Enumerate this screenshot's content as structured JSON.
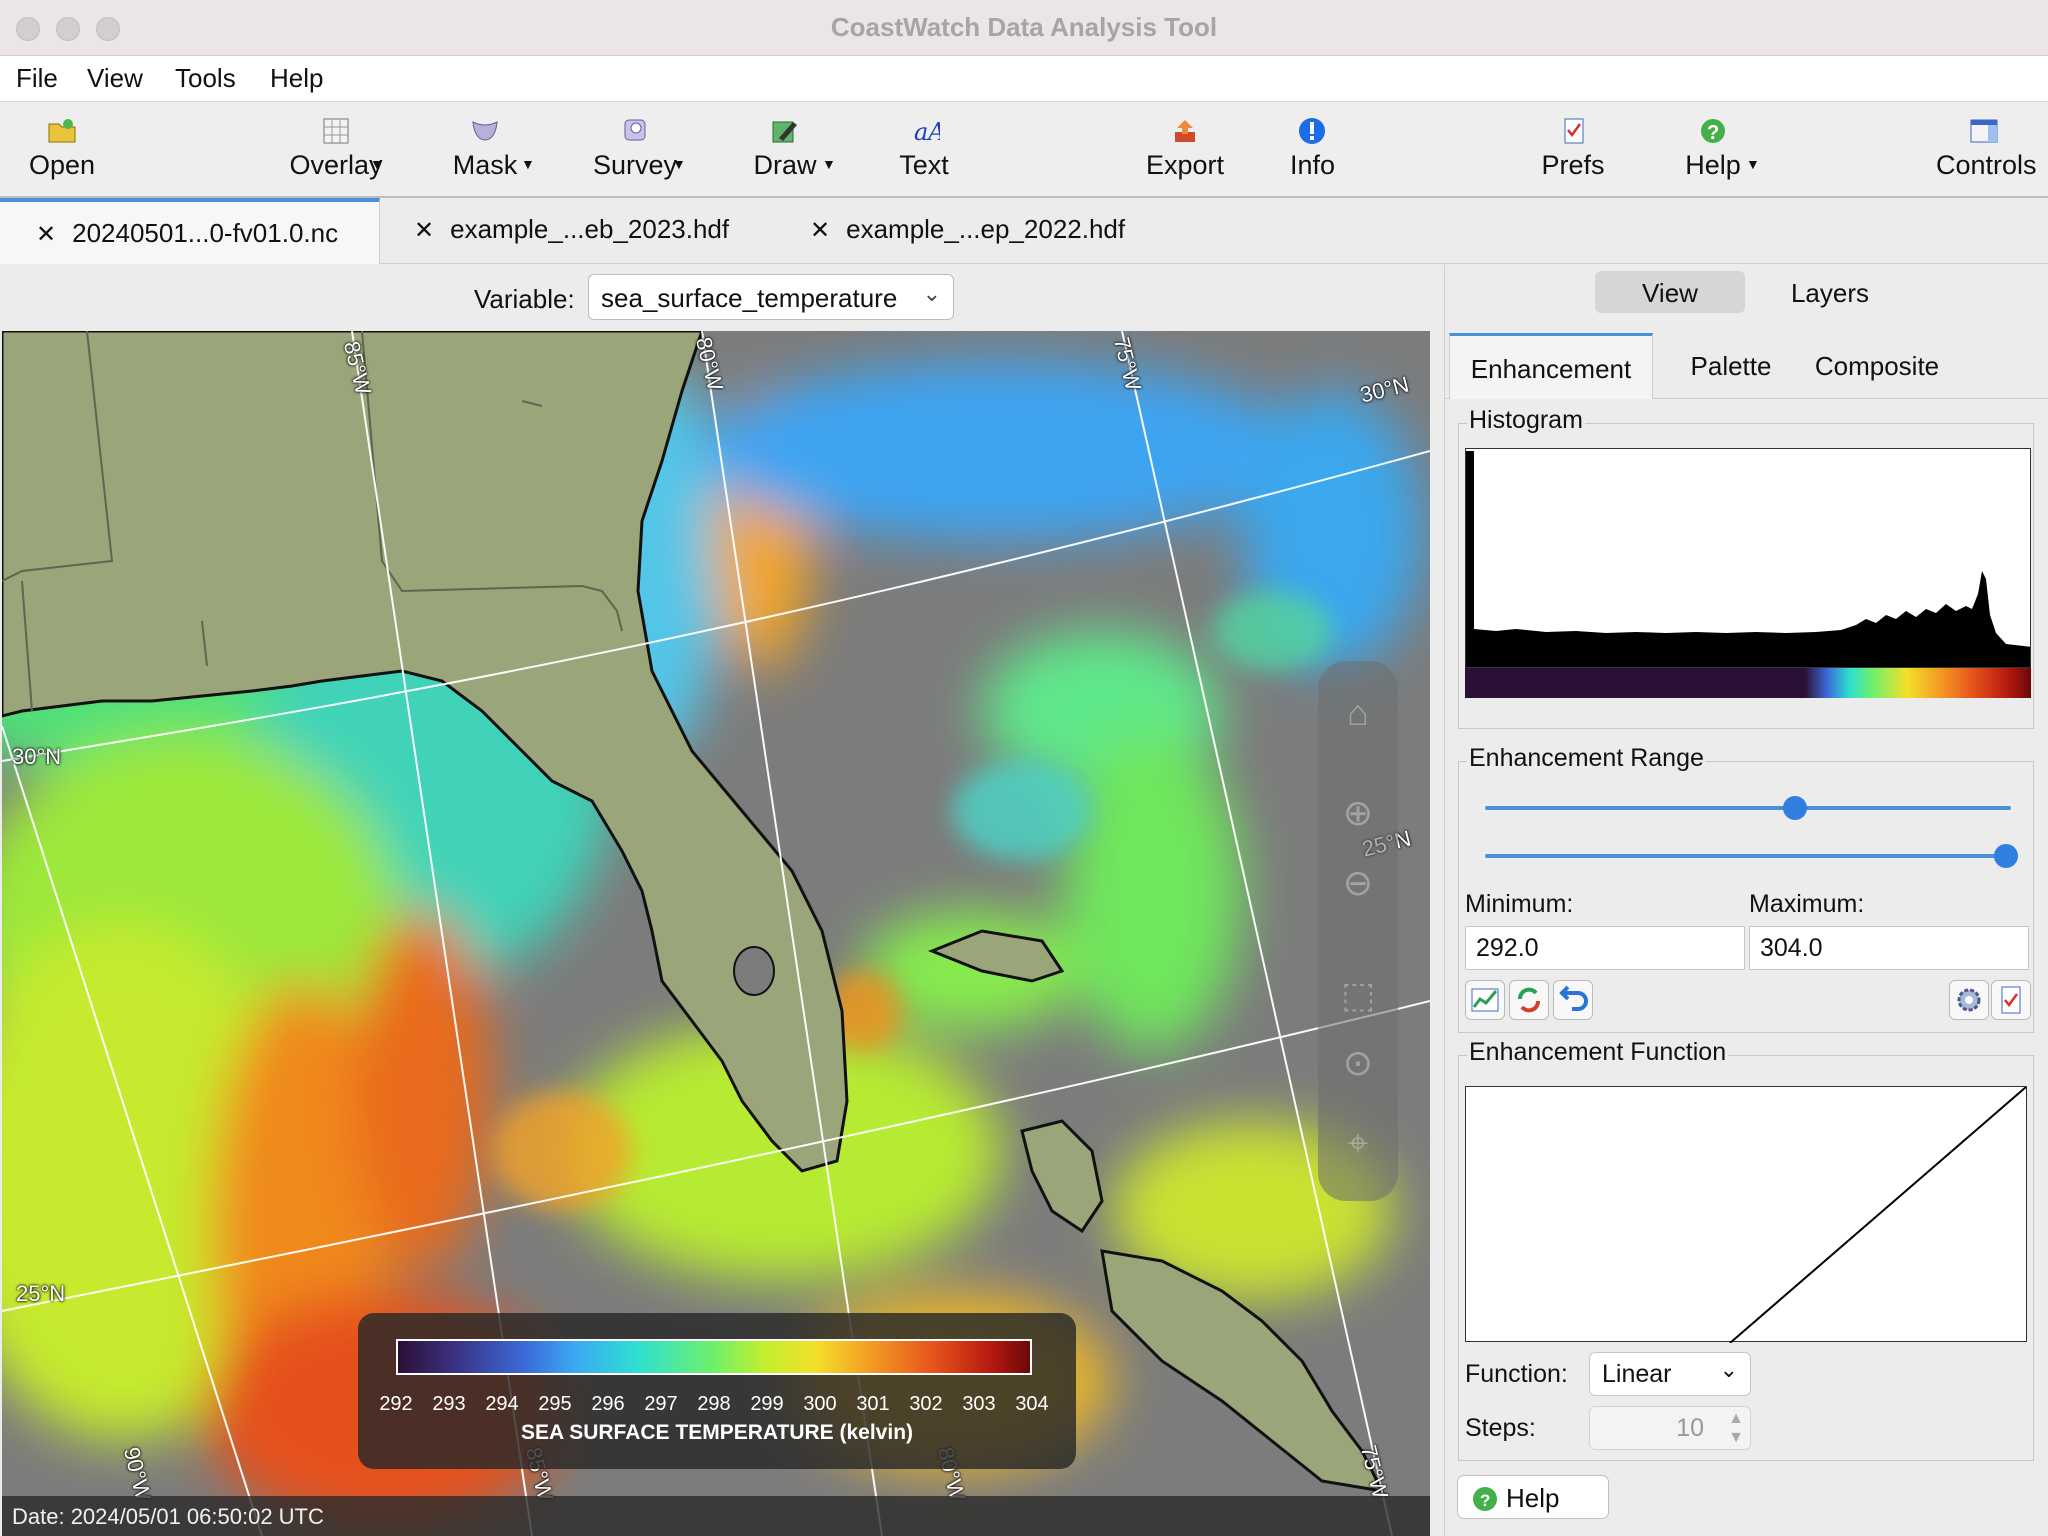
{
  "window": {
    "title": "CoastWatch Data Analysis Tool"
  },
  "menubar": {
    "items": [
      "File",
      "View",
      "Tools",
      "Help"
    ]
  },
  "toolbar": {
    "open": "Open",
    "overlay": "Overlay",
    "mask": "Mask",
    "survey": "Survey",
    "draw": "Draw",
    "text": "Text",
    "export": "Export",
    "info": "Info",
    "prefs": "Prefs",
    "help": "Help",
    "controls": "Controls"
  },
  "tabs": [
    {
      "label": "20240501...0-fv01.0.nc"
    },
    {
      "label": "example_...eb_2023.hdf"
    },
    {
      "label": "example_...ep_2022.hdf"
    }
  ],
  "variable": {
    "label": "Variable:",
    "value": "sea_surface_temperature"
  },
  "map": {
    "date": "Date: 2024/05/01 06:50:02 UTC",
    "lat_labels": [
      "30°N",
      "30°N",
      "25°N",
      "25°N"
    ],
    "lon_labels": [
      "85°W",
      "80°W",
      "75°W",
      "90°W",
      "85°W",
      "80°W",
      "75°W"
    ],
    "legend": {
      "title": "SEA SURFACE TEMPERATURE (kelvin)",
      "ticks": [
        "292",
        "293",
        "294",
        "295",
        "296",
        "297",
        "298",
        "299",
        "300",
        "301",
        "302",
        "303",
        "304"
      ]
    }
  },
  "panel": {
    "segments": {
      "view": "View",
      "layers": "Layers"
    },
    "subtabs": {
      "enhancement": "Enhancement",
      "palette": "Palette",
      "composite": "Composite"
    },
    "histogram_title": "Histogram",
    "range": {
      "title": "Enhancement Range",
      "min_label": "Minimum:",
      "max_label": "Maximum:",
      "min": "292.0",
      "max": "304.0",
      "min_slider_fraction": 0.59,
      "max_slider_fraction": 0.99
    },
    "function": {
      "title": "Enhancement Function",
      "function_label": "Function:",
      "function_value": "Linear",
      "steps_label": "Steps:",
      "steps_value": "10"
    },
    "help_button": "Help"
  },
  "colors": {
    "accent": "#4a90d9",
    "land": "#9aa57a",
    "nodata": "#7c7c7c"
  }
}
